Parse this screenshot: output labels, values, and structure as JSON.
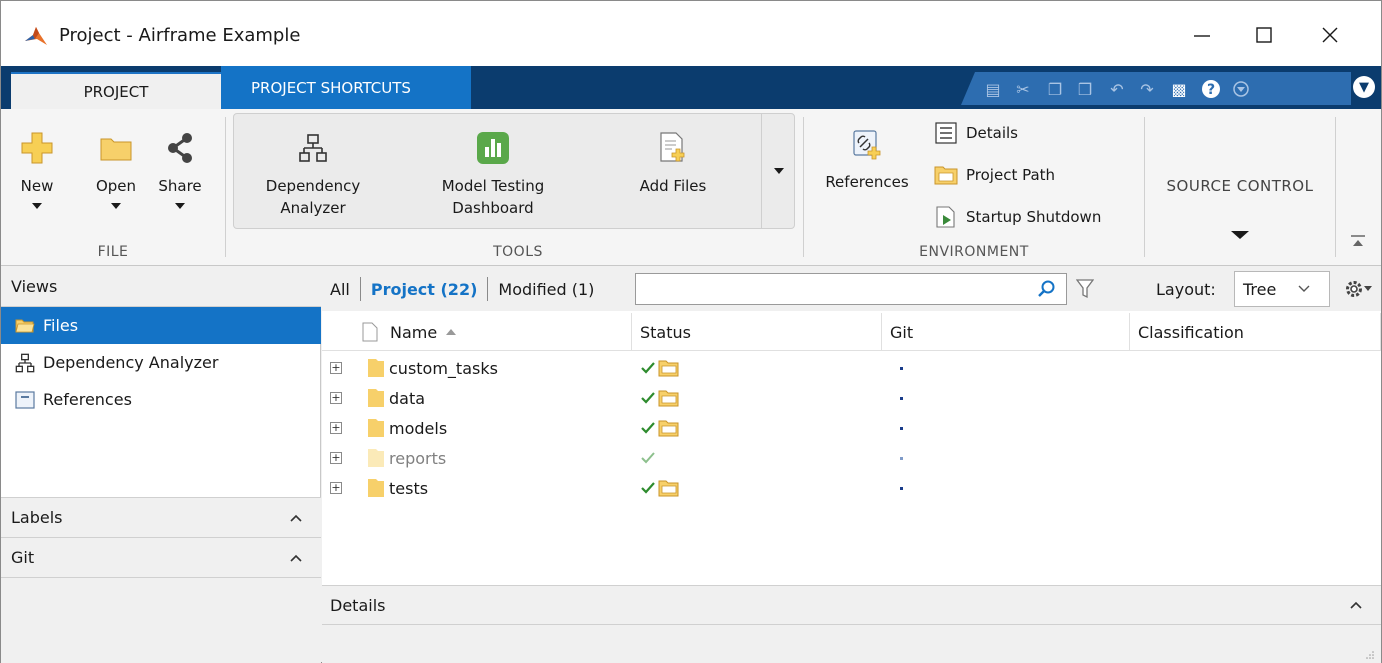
{
  "window": {
    "title": "Project - Airframe Example"
  },
  "tabs": {
    "project": "PROJECT",
    "shortcuts": "PROJECT SHORTCUTS"
  },
  "ribbon": {
    "file": {
      "group_label": "FILE",
      "new": "New",
      "open": "Open",
      "share": "Share"
    },
    "tools": {
      "group_label": "TOOLS",
      "dependency_analyzer_1": "Dependency",
      "dependency_analyzer_2": "Analyzer",
      "model_testing_1": "Model Testing",
      "model_testing_2": "Dashboard",
      "add_files": "Add Files"
    },
    "environment": {
      "group_label": "ENVIRONMENT",
      "references": "References",
      "details": "Details",
      "project_path": "Project Path",
      "startup_shutdown": "Startup Shutdown"
    },
    "source_control": {
      "label": "SOURCE CONTROL"
    }
  },
  "left_pane": {
    "views_header": "Views",
    "views": [
      {
        "label": "Files",
        "icon": "folder-open-icon"
      },
      {
        "label": "Dependency Analyzer",
        "icon": "hierarchy-icon"
      },
      {
        "label": "References",
        "icon": "references-icon"
      }
    ],
    "labels_header": "Labels",
    "git_header": "Git"
  },
  "filter": {
    "all": "All",
    "project": "Project (22)",
    "modified": "Modified (1)",
    "search_value": "",
    "layout_label": "Layout:",
    "layout_value": "Tree"
  },
  "table": {
    "columns": [
      "Name",
      "Status",
      "Git",
      "Classification"
    ],
    "rows": [
      {
        "name": "custom_tasks",
        "status": "in-project",
        "dim": false
      },
      {
        "name": "data",
        "status": "in-project",
        "dim": false
      },
      {
        "name": "models",
        "status": "in-project",
        "dim": false
      },
      {
        "name": "reports",
        "status": "check-only",
        "dim": true
      },
      {
        "name": "tests",
        "status": "in-project",
        "dim": false
      }
    ]
  },
  "details": {
    "label": "Details"
  },
  "colors": {
    "tab_strip": "#0b3c6e",
    "accent_blue": "#1473c6",
    "check_green": "#2e8b2e",
    "folder_yellow": "#f5c542"
  }
}
